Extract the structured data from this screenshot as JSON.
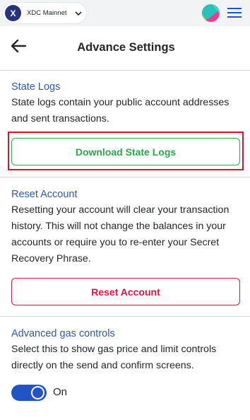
{
  "network": {
    "name": "XDC Mainnet",
    "logo_letter": "X",
    "icon": "chevron-down-icon"
  },
  "header": {
    "title": "Advance Settings",
    "back_icon": "arrow-left-icon"
  },
  "state_logs": {
    "title": "State Logs",
    "description": "State logs contain your public account addresses and sent transactions.",
    "button_label": "Download State Logs"
  },
  "reset_account": {
    "title": "Reset Account",
    "description": "Resetting your account will clear your transaction history. This will not change the balances in your accounts or require you to re-enter your Secret Recovery Phrase.",
    "button_label": "Reset Account"
  },
  "gas_controls": {
    "title": "Advanced gas controls",
    "description": "Select this to show gas price and limit controls directly on the send and confirm screens.",
    "toggle_label": "On",
    "toggle_on": true
  },
  "colors": {
    "accent_blue": "#2154c5",
    "success_green": "#2ea44f",
    "danger_red": "#d7153f",
    "highlight_red": "#d7152a"
  }
}
